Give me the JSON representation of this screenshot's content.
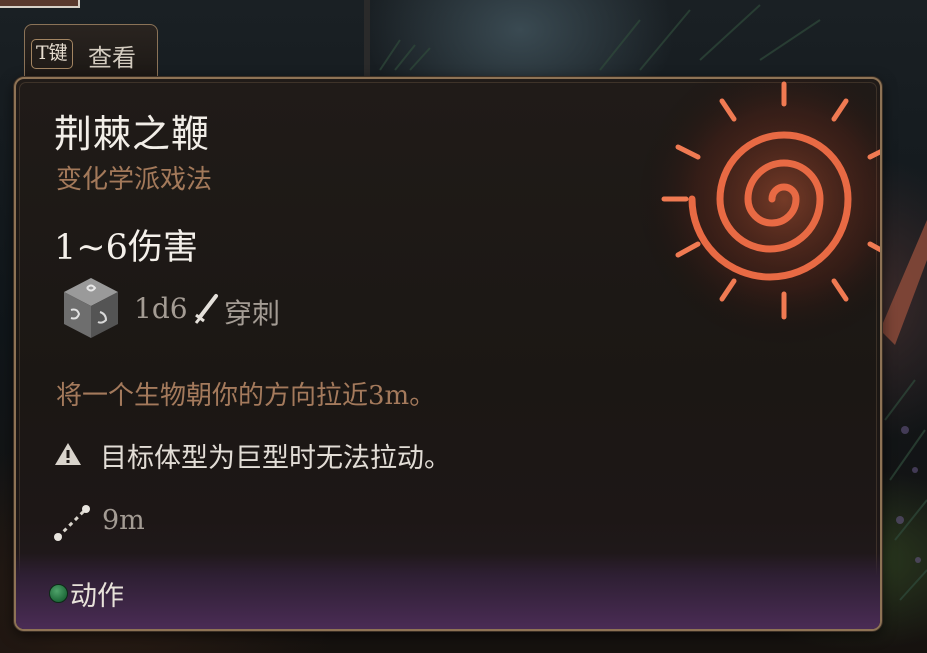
{
  "colors": {
    "panel_border": "#8e7355",
    "title": "#f2eee8",
    "school": "#a3795a",
    "description": "#a47a5c",
    "muted": "#a49c94",
    "action_dot": "#2e8a4e",
    "icon_glow": "#e0643c"
  },
  "view_hint": {
    "key": "T键",
    "label": "查看"
  },
  "spell": {
    "name": "荆棘之鞭",
    "school": "变化学派戏法",
    "damage_summary": "1~6伤害",
    "dice": "1d6",
    "damage_type": "穿刺",
    "description": "将一个生物朝你的方向拉近3m。",
    "warning": "目标体型为巨型时无法拉动。",
    "range": "9m",
    "icon": "thorn-whip-spiral-icon"
  },
  "footer": {
    "action_type": "动作"
  }
}
